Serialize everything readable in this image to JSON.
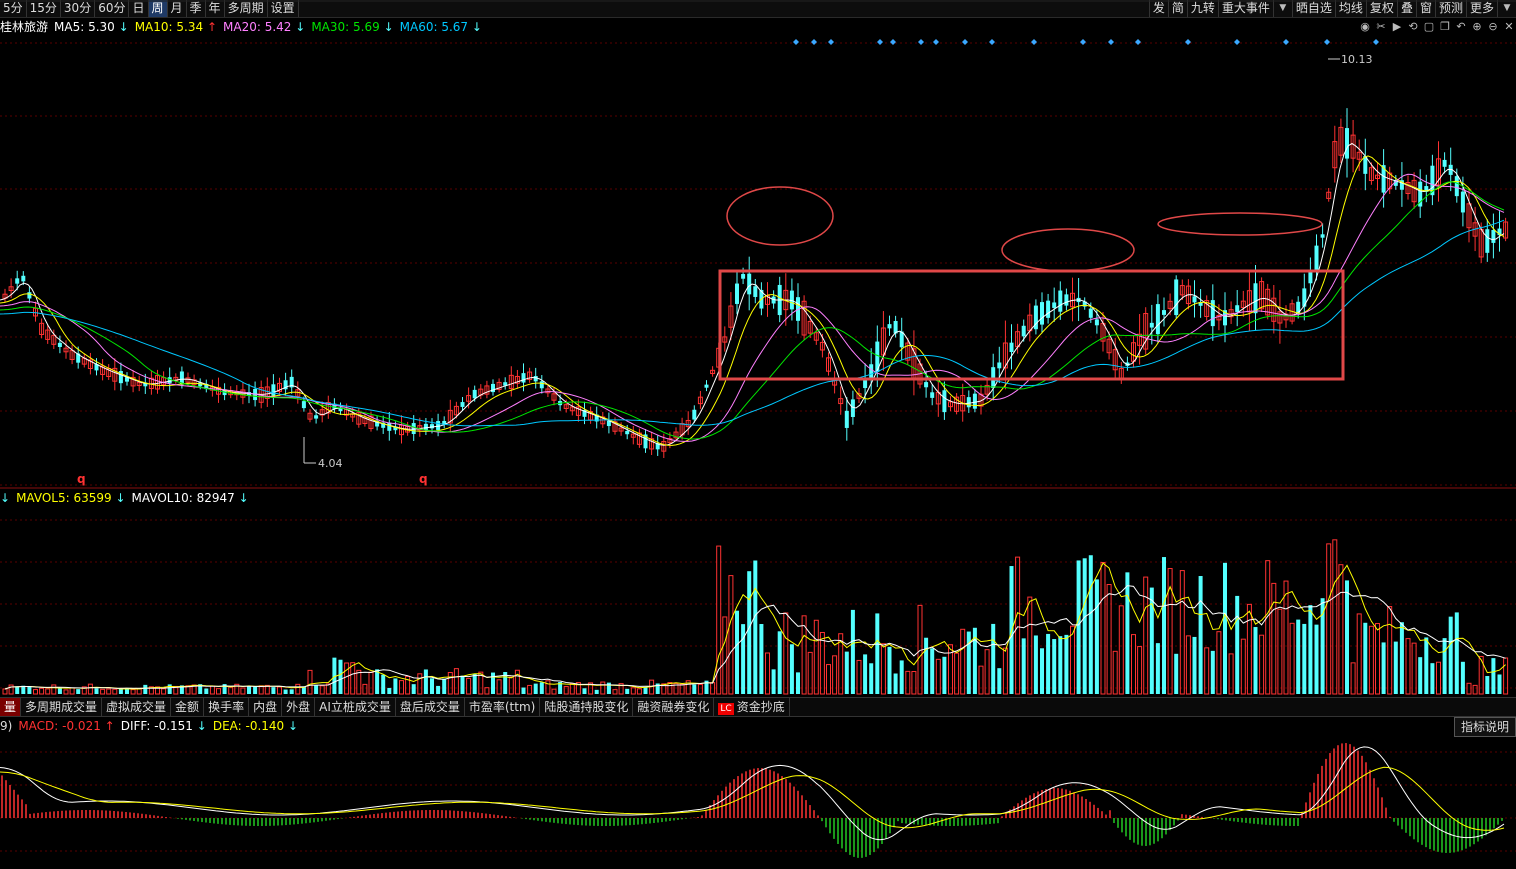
{
  "toolbar": {
    "periods": [
      "5分",
      "15分",
      "30分",
      "60分",
      "日",
      "周",
      "月",
      "季",
      "年",
      "多周期",
      "设置"
    ],
    "active_period": "周",
    "right_items": [
      "发",
      "简",
      "九转",
      "重大事件",
      "▼",
      "晒自选",
      "均线",
      "复权",
      "叠",
      "窗",
      "预测",
      "更多",
      "▼"
    ]
  },
  "price_panel": {
    "stock_name": "桂林旅游",
    "ma5": "MA5: 5.30",
    "ma10": "MA10: 5.34",
    "ma20": "MA20: 5.42",
    "ma30": "MA30: 5.69",
    "ma60": "MA60: 5.67",
    "high_label": "10.13",
    "low_label": "4.04",
    "q_marker": "q"
  },
  "volume_panel": {
    "mavol5": "MAVOL5: 63599",
    "mavol10": "MAVOL10: 82947"
  },
  "tabs": [
    "量",
    "多周期成交量",
    "虚拟成交量",
    "金额",
    "换手率",
    "内盘",
    "外盘",
    "AI立桩成交量",
    "盘后成交量",
    "市盈率(ttm)",
    "陆股通持股变化",
    "融资融券变化",
    "资金抄底"
  ],
  "tabs_badge": "LC",
  "macd_panel": {
    "prefix": "9)",
    "macd": "MACD: -0.021",
    "diff": "DIFF: -0.151",
    "dea": "DEA: -0.140",
    "help": "指标说明"
  },
  "colors": {
    "up": "#ff3232",
    "down": "#54ffff",
    "ma5": "#ffffff",
    "ma10": "#ffff00",
    "ma20": "#ff80ff",
    "ma30": "#00e600",
    "ma60": "#00c8ff",
    "annotation": "#e04848"
  },
  "chart_data": {
    "type": "candlestick",
    "y_high": 10.13,
    "y_low": 4.04
  }
}
